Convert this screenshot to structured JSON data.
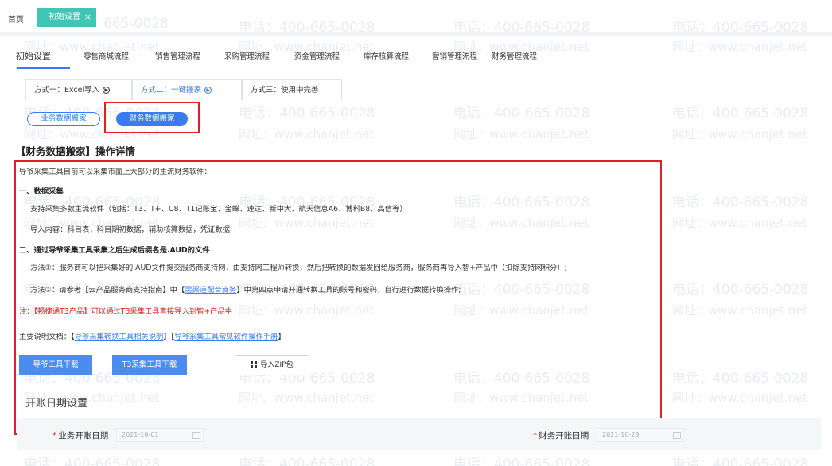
{
  "top_tabs": {
    "home": "首页",
    "active": "初始设置",
    "close": "×"
  },
  "watermark": {
    "phone": "电话：400-665-0028",
    "site": "网址：www.chanjet.net",
    "phone_partial_1": "665-0028",
    "phone_partial_2": "-665-0028",
    "site_partial_1": "chanjet.net",
    "site_partial_2": "anjet.net"
  },
  "flow_nav": [
    "初始设置",
    "零售商城流程",
    "销售管理流程",
    "采购管理流程",
    "资金管理流程",
    "库存核算流程",
    "营销管理流程",
    "财务管理流程"
  ],
  "method_tabs": [
    "方式一：Excel导入",
    "方式二：一键搬家",
    "方式三：使用中完善"
  ],
  "method_icon": "▶",
  "data_buttons": {
    "business": "业务数据搬家",
    "finance": "财务数据搬家"
  },
  "heading": "【财务数据搬家】操作详情",
  "content": {
    "intro": "导爷采集工具目前可以采集市面上大部分的主流财务软件：",
    "sec1_title": "一、数据采集",
    "sec1_line1": "支持采集多款主流软件（包括：T3、T+、U8、T1记账宝、金蝶、速达、新中大、航天信息A6、博科B8、高信等）",
    "sec1_line2": "导入内容：科目表，科目期初数据，辅助核算数据，凭证数据;",
    "sec2_title": "二、通过导爷采集工具采集之后生成后缀名是.AUD的文件",
    "method1": "方法①：服务商可以把采集好的.AUD文件提交服务商支持网，由支持网工程师转换，然后把转换的数据发回给服务商，服务商再导入智+产品中（扣除支持网积分）;",
    "method2_pre": "方法②：请参考【云产品服务商支持指南】中【",
    "method2_link": "需渠道配合商务",
    "method2_post": "】中第四点申请开通转换工具的账号和密码，自行进行数据转换操作;",
    "note": "注：【畅捷通T3产品】可以通过T3采集工具直接导入到智+产品中",
    "docs_pre": "主要说明文档：【",
    "docs_link1": "导爷采集转换工具相关说明",
    "docs_mid": "】【",
    "docs_link2": "导爷采集工具常见软件操作手册",
    "docs_post": "】"
  },
  "buttons": {
    "download1": "导爷工具下载",
    "download2": "T3采集工具下载",
    "import_zip": "导入ZIP包"
  },
  "opening_date": {
    "title": "开账日期设置",
    "business_label": "业务开账日期",
    "business_value": "2021-10-01",
    "finance_label": "财务开账日期",
    "finance_value": "2021-10-29",
    "required_mark": "*"
  },
  "colors": {
    "accent": "#3a7cf0",
    "tab_active": "#3fc6b4",
    "highlight_red": "#e02020"
  }
}
